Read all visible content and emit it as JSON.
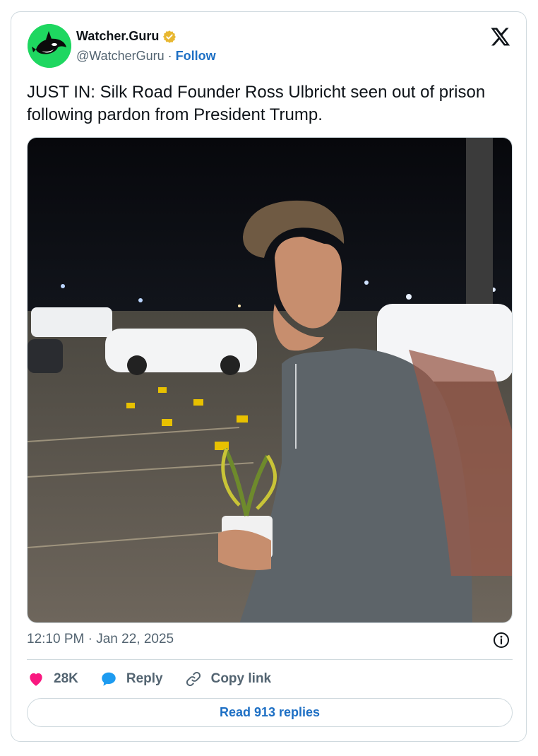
{
  "author": {
    "display_name": "Watcher.Guru",
    "handle": "@WatcherGuru",
    "separator": " · ",
    "follow_label": "Follow",
    "verified_color": "#e8b730",
    "avatar_color": "#1ed760",
    "avatar_icon": "orca-icon"
  },
  "platform_icon": "x-logo-icon",
  "tweet": {
    "text": "JUST IN: Silk Road Founder Ross Ulbricht seen out of prison following pardon from President Trump.",
    "timestamp": "12:10 PM · Jan 22, 2025"
  },
  "actions": {
    "likes": "28K",
    "reply_label": "Reply",
    "copy_label": "Copy link",
    "heart_color": "#f91880",
    "reply_color": "#1d9bf0"
  },
  "footer": {
    "read_replies_label": "Read 913 replies"
  }
}
